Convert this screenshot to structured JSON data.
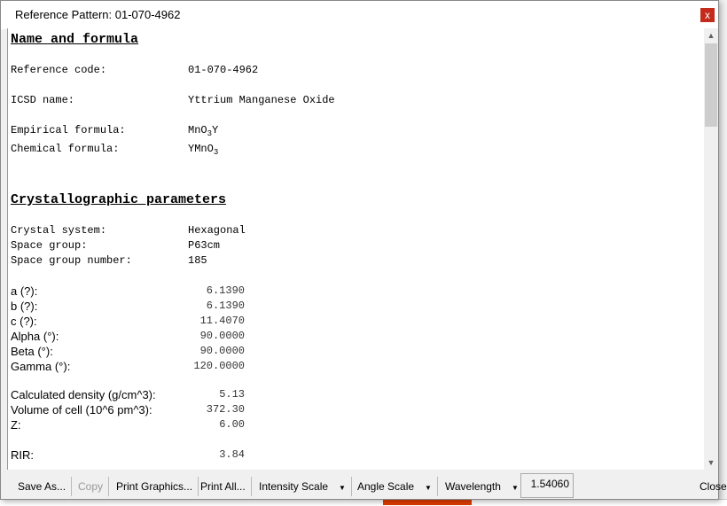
{
  "window": {
    "title": "Reference Pattern: 01-070-4962",
    "close_label": "x"
  },
  "sections": {
    "name_formula": "Name and formula",
    "crystallographic": "Crystallographic parameters"
  },
  "fields": {
    "ref_code_label": "Reference code:",
    "ref_code": "01-070-4962",
    "icsd_label": "ICSD name:",
    "icsd": "Yttrium Manganese Oxide",
    "empirical_label": "Empirical formula:",
    "empirical_a": "MnO",
    "empirical_sub": "3",
    "empirical_b": "Y",
    "chemical_label": "Chemical formula:",
    "chemical_a": "YMnO",
    "chemical_sub": "3",
    "crystal_system_label": "Crystal system:",
    "crystal_system": "Hexagonal",
    "space_group_label": "Space group:",
    "space_group": "P63cm",
    "space_group_number_label": "Space group number:",
    "space_group_number": "185"
  },
  "params": [
    {
      "label": "a (?):",
      "value": "6.1390"
    },
    {
      "label": "b (?):",
      "value": "6.1390"
    },
    {
      "label": "c (?):",
      "value": "11.4070"
    },
    {
      "label": "Alpha (°):",
      "value": "90.0000"
    },
    {
      "label": "Beta (°):",
      "value": "90.0000"
    },
    {
      "label": "Gamma (°):",
      "value": "120.0000"
    },
    {
      "label": "Calculated density (g/cm^3):",
      "value": "5.13"
    },
    {
      "label": "Volume of cell (10^6 pm^3):",
      "value": "372.30"
    },
    {
      "label": "Z:",
      "value": "6.00"
    },
    {
      "label": "RIR:",
      "value": "3.84"
    }
  ],
  "toolbar": {
    "save_as": "Save As...",
    "copy": "Copy",
    "print_graphics": "Print Graphics...",
    "print_all": "Print All...",
    "intensity_scale": "Intensity Scale",
    "angle_scale": "Angle Scale",
    "wavelength": "Wavelength",
    "wavelength_value": "1.54060",
    "close": "Close"
  }
}
